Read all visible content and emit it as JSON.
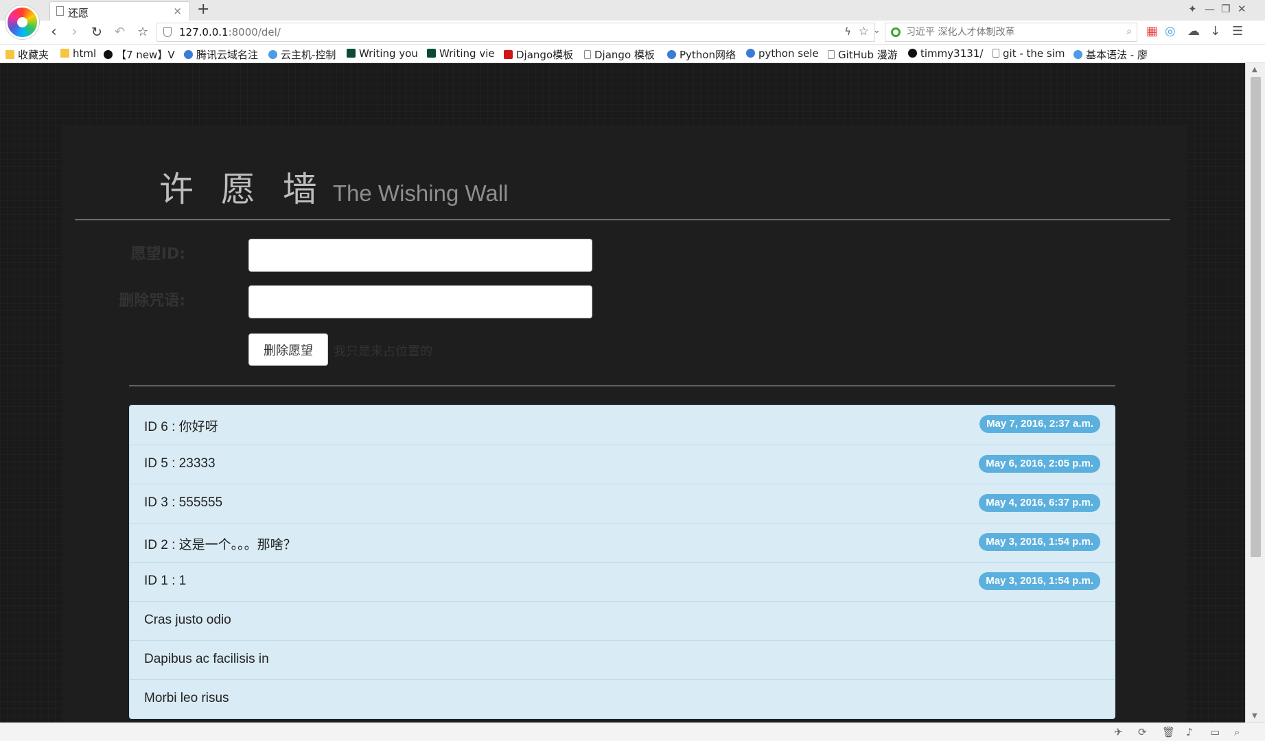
{
  "browser": {
    "tab_title": "还愿",
    "tab_close": "×",
    "new_tab": "+",
    "url_host": "127.0.0.1",
    "url_rest": ":8000/del/",
    "search_placeholder": "习近平 深化人才体制改革",
    "window_controls": [
      "—",
      "❐",
      "✕"
    ],
    "bookmarks": [
      {
        "label": "收藏夹",
        "icon": "folder-icon"
      },
      {
        "label": "html",
        "icon": "folder-icon"
      },
      {
        "label": "【7 new】V",
        "icon": "robot-icon"
      },
      {
        "label": "腾讯云域名注",
        "icon": "tencent-icon"
      },
      {
        "label": "云主机-控制",
        "icon": "cloud-icon"
      },
      {
        "label": "Writing you",
        "icon": "django-icon"
      },
      {
        "label": "Writing vie",
        "icon": "django-icon"
      },
      {
        "label": "Django模板",
        "icon": "csdn-icon"
      },
      {
        "label": "Django 模板",
        "icon": "page-icon"
      },
      {
        "label": "Python网络",
        "icon": "python-icon"
      },
      {
        "label": "python sele",
        "icon": "baidu-icon"
      },
      {
        "label": "GitHub 漫游",
        "icon": "page-icon"
      },
      {
        "label": "timmy3131/",
        "icon": "github-icon"
      },
      {
        "label": "git - the sim",
        "icon": "page-icon"
      },
      {
        "label": "基本语法 - 廖",
        "icon": "rocket-icon"
      }
    ]
  },
  "page": {
    "heading_cn": "许 愿 墙",
    "heading_en": "The Wishing Wall",
    "wish_id_label": "愿望ID:",
    "wish_id_value": "",
    "spell_label": "删除咒语:",
    "spell_value": "",
    "delete_button": "删除愿望",
    "placeholder_text": "我只是来占位置的",
    "wishes": [
      {
        "text": "ID 6 : 你好呀",
        "date": "May 7, 2016, 2:37 a.m."
      },
      {
        "text": "ID 5 : 23333",
        "date": "May 6, 2016, 2:05 p.m."
      },
      {
        "text": "ID 3 : 555555",
        "date": "May 4, 2016, 6:37 p.m."
      },
      {
        "text": "ID 2 : 这是一个。。。那啥？",
        "date": "May 3, 2016, 1:54 p.m."
      },
      {
        "text": "ID 1 : 1",
        "date": "May 3, 2016, 1:54 p.m."
      },
      {
        "text": "Cras justo odio",
        "date": ""
      },
      {
        "text": "Dapibus ac facilisis in",
        "date": ""
      },
      {
        "text": "Morbi leo risus",
        "date": ""
      }
    ]
  },
  "colors": {
    "background": "#1a1a1a",
    "panel": "#1e1e1e",
    "list_bg": "#d9ebf5",
    "badge": "#5bb0de"
  }
}
